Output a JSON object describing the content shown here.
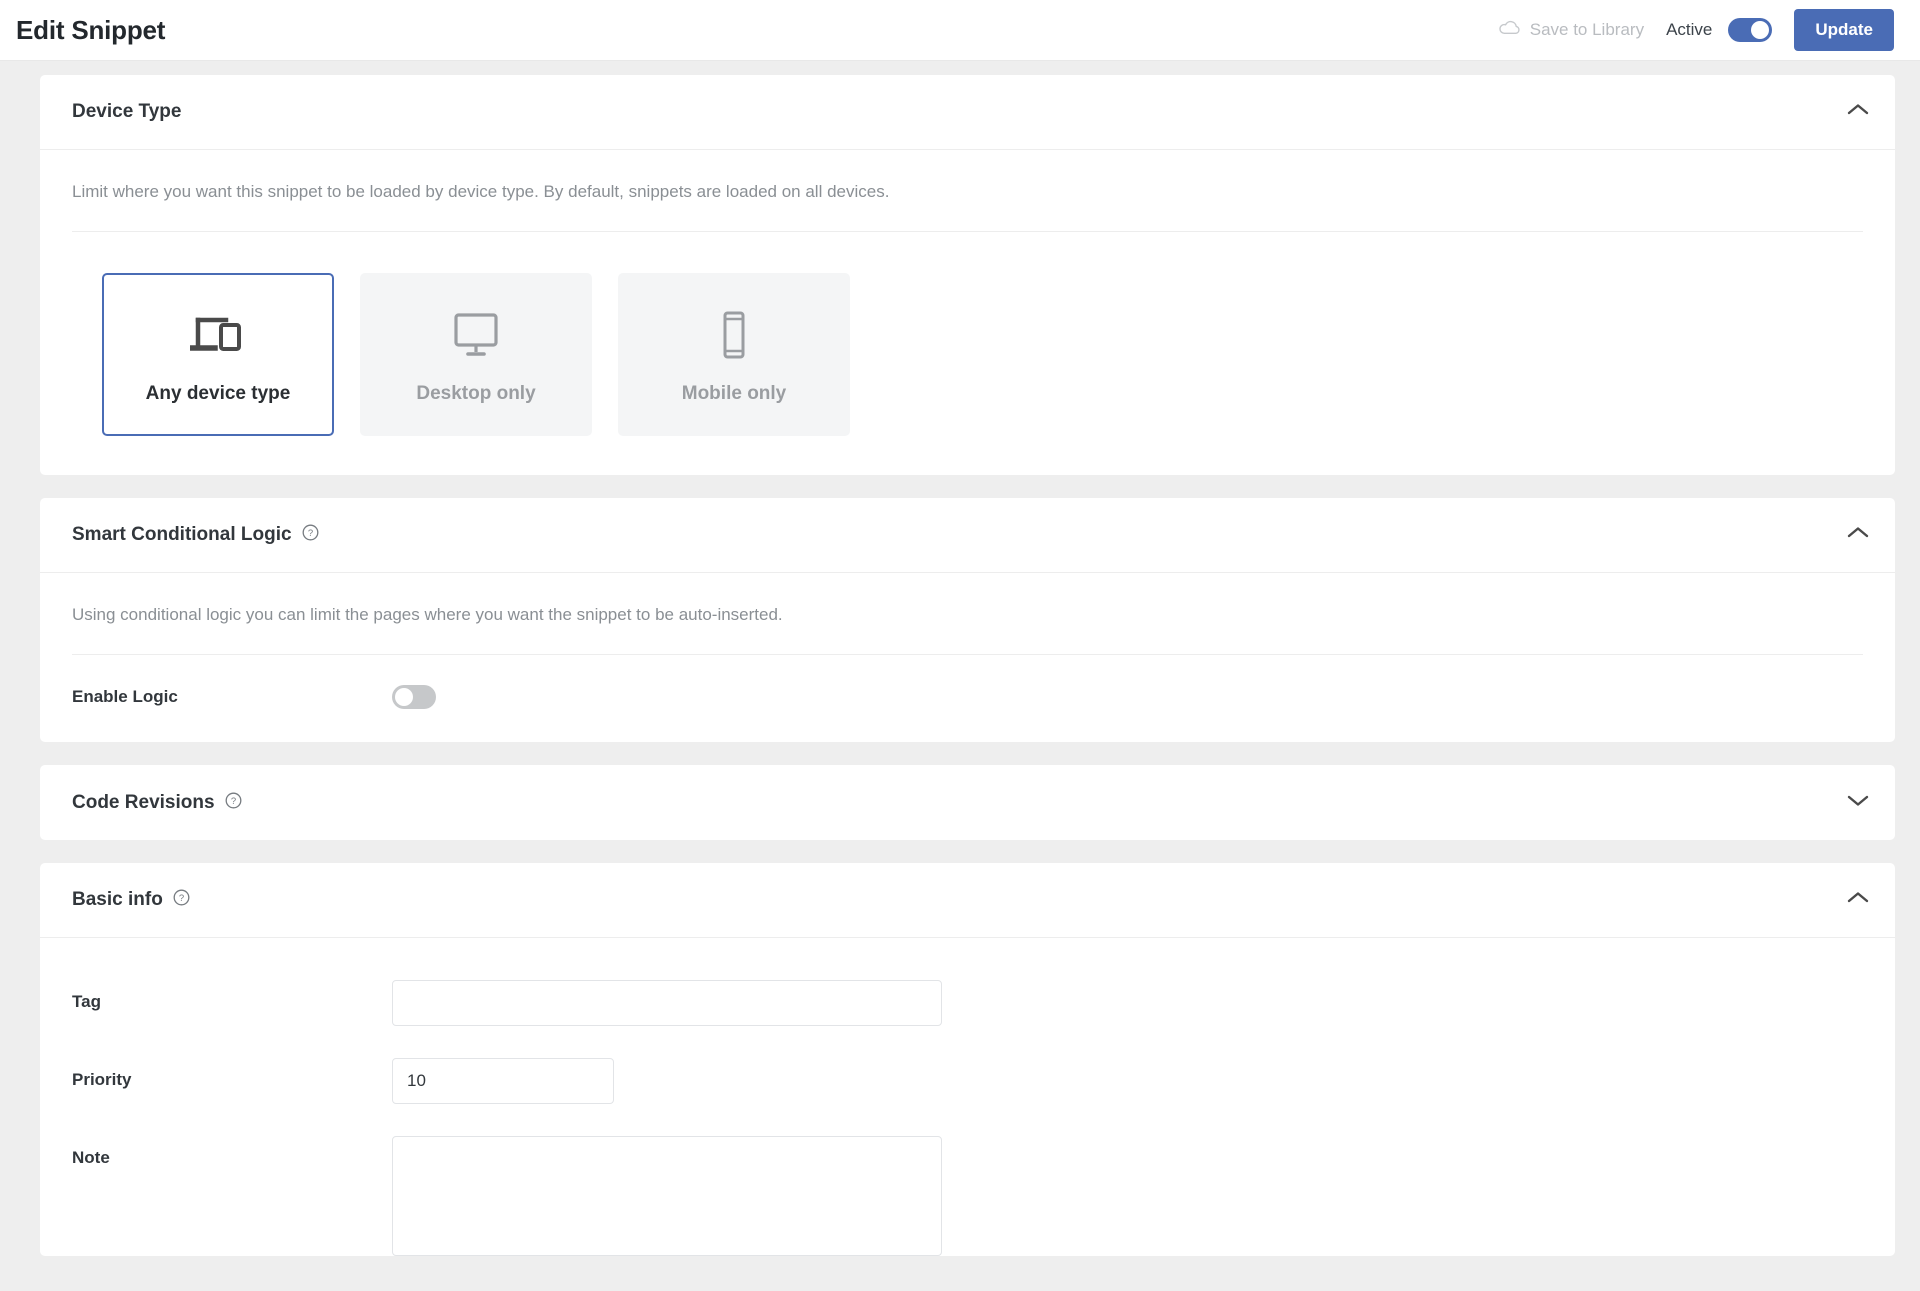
{
  "header": {
    "title": "Edit Snippet",
    "cloud_icon": "cloud-icon",
    "save_to_library_label": "Save to Library",
    "active_label": "Active",
    "active_state": "on",
    "update_label": "Update",
    "accent_color": "#4a6cb5"
  },
  "device_type": {
    "title": "Device Type",
    "collapse_icon": "chevron-up-icon",
    "description": "Limit where you want this snippet to be loaded by device type. By default, snippets are loaded on all devices.",
    "options": [
      {
        "label": "Any device type",
        "icon": "devices-icon",
        "selected": true
      },
      {
        "label": "Desktop only",
        "icon": "monitor-icon",
        "selected": false
      },
      {
        "label": "Mobile only",
        "icon": "mobile-icon",
        "selected": false
      }
    ]
  },
  "smart_conditional_logic": {
    "title": "Smart Conditional Logic",
    "help_icon": "help-circle-icon",
    "collapse_icon": "chevron-up-icon",
    "description": "Using conditional logic you can limit the pages where you want the snippet to be auto-inserted.",
    "enable_logic_label": "Enable Logic",
    "enable_logic_state": "off"
  },
  "code_revisions": {
    "title": "Code Revisions",
    "help_icon": "help-circle-icon",
    "collapse_icon": "chevron-down-icon"
  },
  "basic_info": {
    "title": "Basic info",
    "help_icon": "help-circle-icon",
    "collapse_icon": "chevron-up-icon",
    "fields": [
      {
        "label": "Tag",
        "value": "",
        "placeholder": ""
      },
      {
        "label": "Priority",
        "value": "10",
        "placeholder": ""
      },
      {
        "label": "Note",
        "value": "",
        "placeholder": ""
      }
    ]
  }
}
